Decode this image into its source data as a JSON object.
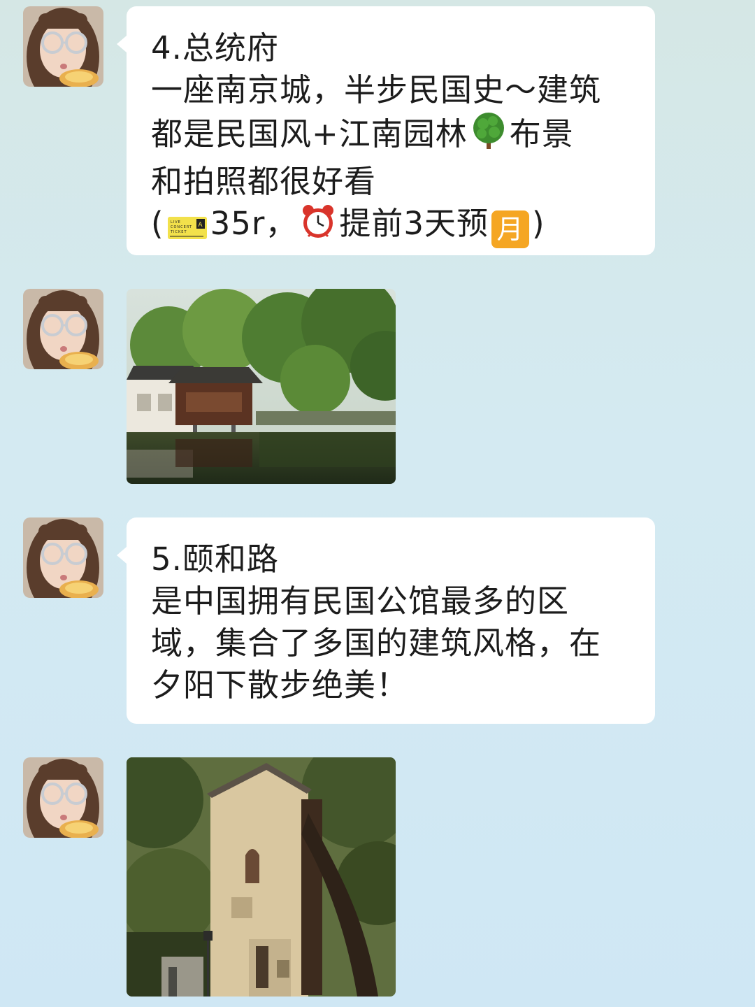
{
  "messages": [
    {
      "type": "text",
      "lines": [
        "4.总统府",
        "一座南京城，半步民国史～建筑",
        "都是民国风+江南园林",
        "和拍照都很好看"
      ],
      "line3_suffix": "布景",
      "line5_prefix": "(",
      "price": "35r，",
      "booking": "提前3天预",
      "month_badge": "月",
      "line5_suffix": ")",
      "ticket_text": "LIVE CONCERT TICKET",
      "icons": [
        "tree-emoji-icon",
        "ticket-emoji-icon",
        "alarm-clock-emoji-icon",
        "month-calendar-icon"
      ]
    },
    {
      "type": "image",
      "description_icon": "garden-pavilion-photo"
    },
    {
      "type": "text",
      "lines": [
        "5.颐和路",
        "是中国拥有民国公馆最多的区",
        "域，集合了多国的建筑风格，在",
        "夕阳下散步绝美！"
      ]
    },
    {
      "type": "image",
      "description_icon": "old-villa-photo"
    }
  ],
  "colors": {
    "bubble": "#ffffff",
    "text": "#1c1c1c",
    "badge": "#f5a623"
  }
}
